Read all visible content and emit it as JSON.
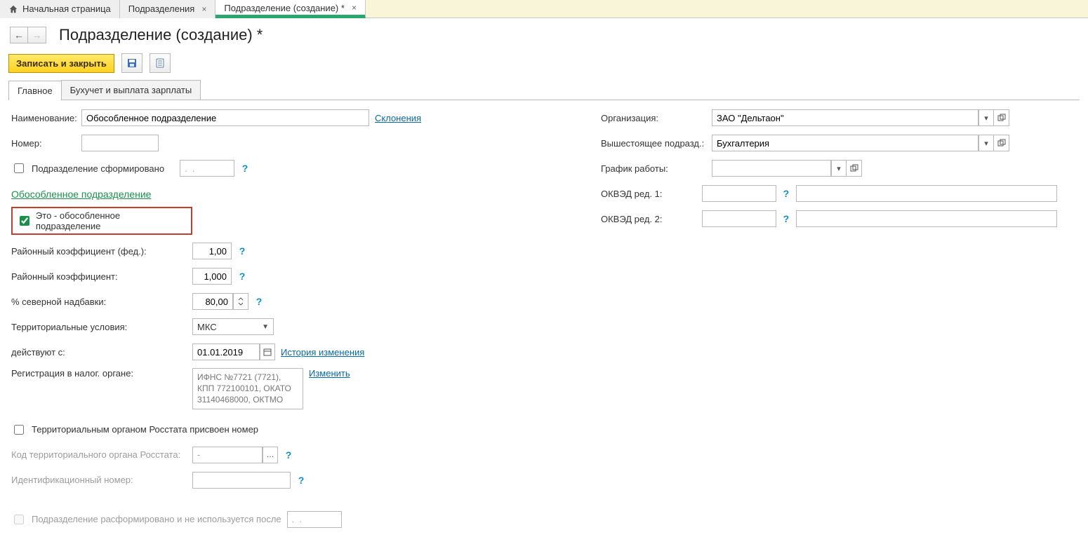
{
  "tabs": {
    "home": "Начальная страница",
    "departments": "Подразделения",
    "creation": "Подразделение (создание) *"
  },
  "page_title": "Подразделение (создание) *",
  "toolbar": {
    "save_close": "Записать и закрыть"
  },
  "content_tabs": {
    "main": "Главное",
    "acc": "Бухучет и выплата зарплаты"
  },
  "left": {
    "name_label": "Наименование:",
    "name_value": "Обособленное подразделение",
    "declensions": "Склонения",
    "number_label": "Номер:",
    "formed_label": "Подразделение сформировано",
    "formed_date": ".  .",
    "section": "Обособленное подразделение",
    "isolated_chk": "Это - обособленное подразделение",
    "coef_fed_label": "Районный коэффициент (фед.):",
    "coef_fed_val": "1,00",
    "coef_label": "Районный коэффициент:",
    "coef_val": "1,000",
    "north_label": "% северной надбавки:",
    "north_val": "80,00",
    "terr_label": "Территориальные условия:",
    "terr_val": "МКС",
    "since_label": "действуют с:",
    "since_val": "01.01.2019",
    "history": "История изменения",
    "tax_label": "Регистрация в налог. органе:",
    "tax_val": "ИФНС №7721 (7721), КПП 772100101, ОКАТО 31140468000, ОКТМО",
    "change": "Изменить",
    "rosstat_label": "Территориальным органом Росстата присвоен номер",
    "rosstat_code_label": "Код территориального органа Росстата:",
    "rosstat_code_val": "-",
    "id_label": "Идентификационный номер:",
    "disbanded_label": "Подразделение расформировано и не используется после",
    "disbanded_date": ".  ."
  },
  "right": {
    "org_label": "Организация:",
    "org_val": "ЗАО \"Дельтаон\"",
    "parent_label": "Вышестоящее подразд.:",
    "parent_val": "Бухгалтерия",
    "schedule_label": "График работы:",
    "okved1_label": "ОКВЭД ред. 1:",
    "okved2_label": "ОКВЭД ред. 2:"
  }
}
